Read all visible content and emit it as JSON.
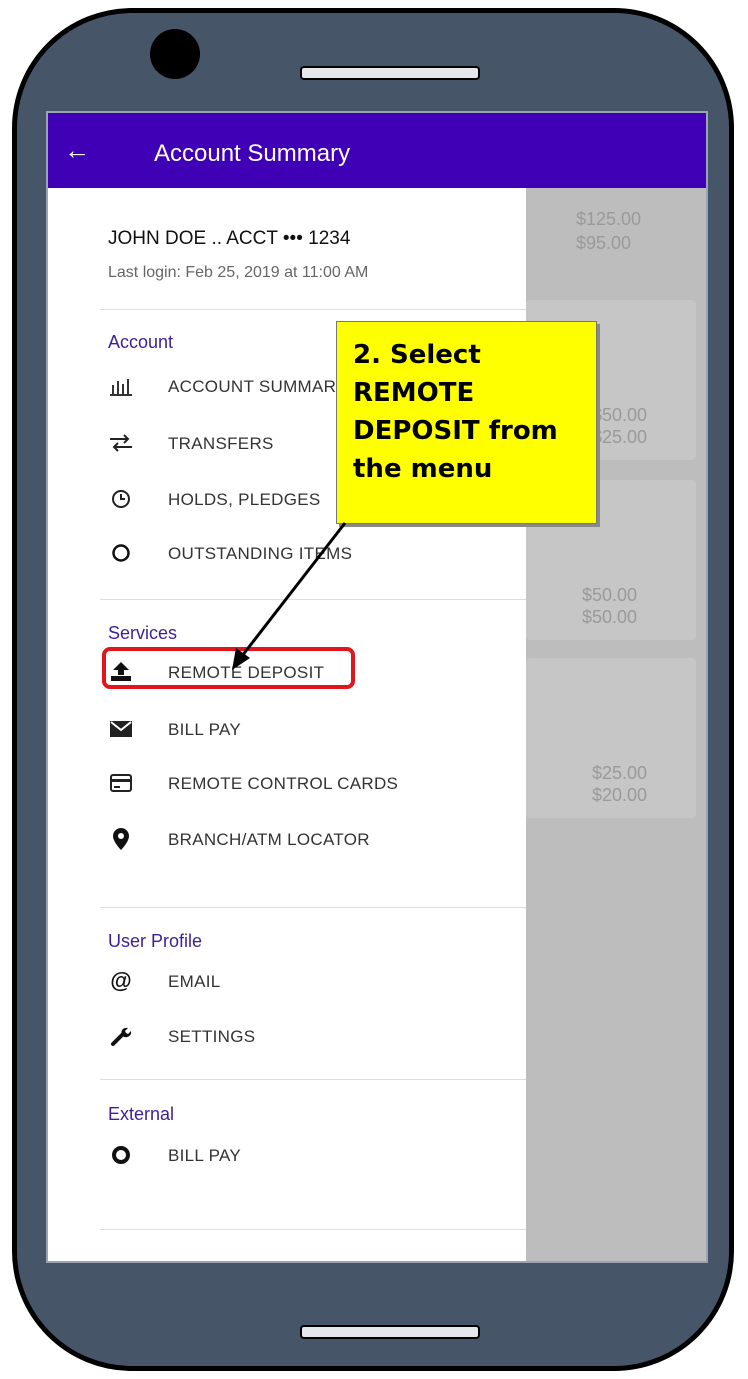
{
  "header": {
    "title": "Account Summary",
    "back_icon": "←"
  },
  "account": {
    "name": "JOHN DOE .. ACCT ••• 1234",
    "last_login": "Last login: Feb 25, 2019 at 11:00 AM"
  },
  "background_amounts": [
    "$125.00",
    "$95.00",
    "$50.00",
    "$25.00",
    "$50.00",
    "$50.00",
    "$25.00",
    "$20.00"
  ],
  "sections": {
    "account": {
      "title": "Account",
      "items": [
        {
          "label": "ACCOUNT SUMMARY",
          "icon": "bar-chart-icon"
        },
        {
          "label": "TRANSFERS",
          "icon": "swap-icon"
        },
        {
          "label": "HOLDS, PLEDGES",
          "icon": "clock-icon"
        },
        {
          "label": "OUTSTANDING ITEMS",
          "icon": "circle-outline-icon"
        }
      ]
    },
    "services": {
      "title": "Services",
      "items": [
        {
          "label": "REMOTE DEPOSIT",
          "icon": "upload-icon"
        },
        {
          "label": "BILL PAY",
          "icon": "envelope-icon"
        },
        {
          "label": "REMOTE CONTROL CARDS",
          "icon": "credit-card-icon"
        },
        {
          "label": "BRANCH/ATM LOCATOR",
          "icon": "map-pin-icon"
        }
      ]
    },
    "user_profile": {
      "title": "User Profile",
      "items": [
        {
          "label": "EMAIL",
          "icon": "at-icon"
        },
        {
          "label": "SETTINGS",
          "icon": "wrench-icon"
        }
      ]
    },
    "external": {
      "title": "External",
      "items": [
        {
          "label": "BILL PAY",
          "icon": "circle-thick-icon"
        }
      ]
    }
  },
  "callout": {
    "lines": [
      "2. Select",
      "REMOTE",
      "DEPOSIT from",
      "the menu"
    ]
  },
  "colors": {
    "appbar": "#3f00b6",
    "section_title": "#3d1f99",
    "highlight": "#e0161b",
    "callout": "#ffff00"
  }
}
